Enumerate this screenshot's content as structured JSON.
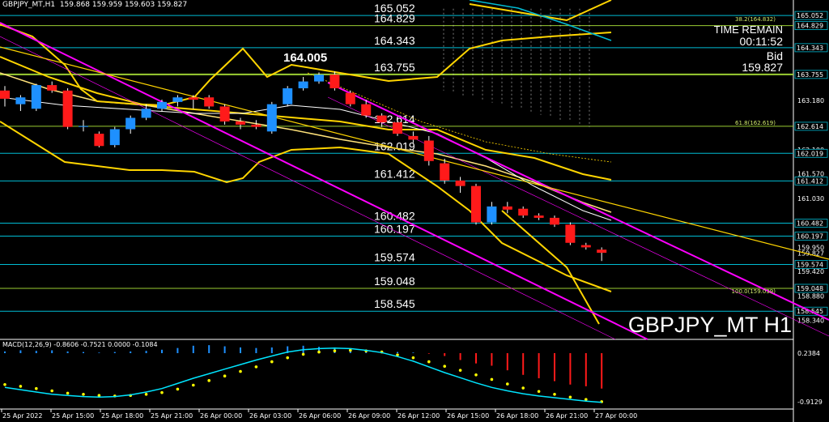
{
  "header": {
    "symbol_info": "GBPJPY_MT,H1",
    "ohlc": "159.868 159.959 159.603 159.827"
  },
  "symbol_label": "GBPJPY_MT H1",
  "timer": {
    "label": "TIME REMAIN",
    "value": "00:11:52",
    "bid_label": "Bid",
    "bid_value": "159.827"
  },
  "macd": {
    "header": "MACD(12,26,9) -0.8606 -0.7521 0.0000 -0.1084",
    "axis_top": "0.2384",
    "axis_bottom": "-0.9129"
  },
  "fib_annotations": [
    "38.2(164.832)",
    "61.8(162.619)",
    "100.0(159.039)"
  ],
  "colors": {
    "bull": "#1e90ff",
    "bear": "#ff1a1a",
    "bands": "#ffd500",
    "channel": "#ff00ff",
    "level": "#00bcd4",
    "macd_signal": "#ffff00",
    "macd_line": "#00e5ff"
  },
  "chart_data": {
    "type": "candlestick",
    "title": "GBPJPY_MT H1",
    "ylim": [
      158.05,
      165.25
    ],
    "y_ticks": [
      "165.052",
      "164.829",
      "164.343",
      "163.755",
      "163.180",
      "162.614",
      "162.100",
      "162.019",
      "161.570",
      "161.412",
      "161.030",
      "160.482",
      "160.197",
      "159.950",
      "159.827",
      "159.574",
      "159.420",
      "159.048",
      "158.880",
      "158.545",
      "158.340"
    ],
    "x_ticks": [
      "25 Apr 2022",
      "25 Apr 15:00",
      "25 Apr 18:00",
      "25 Apr 21:00",
      "26 Apr 00:00",
      "26 Apr 03:00",
      "26 Apr 06:00",
      "26 Apr 09:00",
      "26 Apr 12:00",
      "26 Apr 15:00",
      "26 Apr 18:00",
      "26 Apr 21:00",
      "27 Apr 00:00"
    ],
    "levels": [
      {
        "label": "165.052",
        "value": 165.052
      },
      {
        "label": "164.829",
        "value": 164.829
      },
      {
        "label": "164.343",
        "value": 164.343
      },
      {
        "label": "163.755",
        "value": 163.755
      },
      {
        "label": "162.614",
        "value": 162.614
      },
      {
        "label": "162.019",
        "value": 162.019
      },
      {
        "label": "161.412",
        "value": 161.412
      },
      {
        "label": "160.482",
        "value": 160.482
      },
      {
        "label": "160.197",
        "value": 160.197
      },
      {
        "label": "159.574",
        "value": 159.574
      },
      {
        "label": "159.048",
        "value": 159.048
      },
      {
        "label": "158.545",
        "value": 158.545
      }
    ],
    "peak_label": {
      "text": "164.005",
      "value": 164.005
    },
    "candles": [
      [
        163.4,
        163.5,
        163.05,
        163.22
      ],
      [
        163.1,
        163.3,
        162.95,
        163.25
      ],
      [
        163.0,
        163.55,
        162.95,
        163.52
      ],
      [
        163.52,
        163.6,
        163.35,
        163.4
      ],
      [
        163.4,
        163.45,
        162.55,
        162.6
      ],
      [
        162.6,
        162.75,
        162.5,
        162.62
      ],
      [
        162.45,
        162.5,
        162.15,
        162.18
      ],
      [
        162.2,
        162.6,
        162.15,
        162.55
      ],
      [
        162.55,
        162.85,
        162.45,
        162.8
      ],
      [
        162.8,
        163.1,
        162.75,
        163.0
      ],
      [
        163.0,
        163.2,
        162.95,
        163.15
      ],
      [
        163.15,
        163.3,
        163.05,
        163.25
      ],
      [
        163.25,
        163.3,
        163.0,
        163.2
      ],
      [
        163.25,
        163.3,
        163.0,
        163.05
      ],
      [
        163.05,
        163.1,
        162.65,
        162.72
      ],
      [
        162.72,
        162.8,
        162.55,
        162.65
      ],
      [
        162.65,
        162.75,
        162.55,
        162.6
      ],
      [
        162.5,
        163.15,
        162.45,
        163.1
      ],
      [
        163.1,
        163.5,
        163.05,
        163.45
      ],
      [
        163.45,
        163.7,
        163.4,
        163.6
      ],
      [
        163.6,
        163.8,
        163.55,
        163.75
      ],
      [
        163.75,
        163.82,
        163.4,
        163.45
      ],
      [
        163.35,
        163.4,
        163.05,
        163.1
      ],
      [
        163.1,
        163.2,
        162.8,
        162.85
      ],
      [
        162.85,
        162.9,
        162.6,
        162.7
      ],
      [
        162.7,
        162.8,
        162.4,
        162.45
      ],
      [
        162.4,
        162.5,
        162.25,
        162.32
      ],
      [
        162.3,
        162.4,
        161.75,
        161.85
      ],
      [
        161.8,
        161.9,
        161.35,
        161.42
      ],
      [
        161.42,
        161.5,
        161.15,
        161.3
      ],
      [
        161.3,
        161.35,
        160.45,
        160.5
      ],
      [
        160.5,
        160.95,
        160.45,
        160.85
      ],
      [
        160.85,
        160.95,
        160.7,
        160.78
      ],
      [
        160.8,
        160.85,
        160.6,
        160.65
      ],
      [
        160.65,
        160.7,
        160.55,
        160.6
      ],
      [
        160.6,
        160.65,
        160.4,
        160.45
      ],
      [
        160.45,
        160.5,
        160.0,
        160.05
      ],
      [
        160.0,
        160.05,
        159.9,
        159.95
      ],
      [
        159.9,
        159.95,
        159.65,
        159.83
      ]
    ],
    "macd_hist": [
      0.03,
      0.05,
      0.04,
      0.05,
      0.03,
      0.02,
      0.01,
      0.02,
      0.03,
      0.04,
      0.06,
      0.09,
      0.13,
      0.14,
      0.12,
      0.1,
      0.09,
      0.1,
      0.12,
      0.13,
      0.11,
      0.1,
      0.07,
      0.05,
      0.03,
      0.02,
      0.01,
      -0.01,
      -0.05,
      -0.12,
      -0.18,
      -0.22,
      -0.3,
      -0.38,
      -0.44,
      -0.49,
      -0.55,
      -0.58,
      -0.62
    ],
    "macd_signal": [
      -0.55,
      -0.58,
      -0.62,
      -0.66,
      -0.7,
      -0.72,
      -0.74,
      -0.75,
      -0.74,
      -0.72,
      -0.69,
      -0.63,
      -0.56,
      -0.48,
      -0.4,
      -0.32,
      -0.24,
      -0.15,
      -0.08,
      -0.02,
      0.02,
      0.04,
      0.05,
      0.04,
      0.02,
      -0.03,
      -0.08,
      -0.15,
      -0.23,
      -0.3,
      -0.38,
      -0.46,
      -0.54,
      -0.61,
      -0.67,
      -0.72,
      -0.77,
      -0.81,
      -0.85
    ],
    "macd_line": [
      -0.6,
      -0.64,
      -0.68,
      -0.72,
      -0.74,
      -0.76,
      -0.77,
      -0.76,
      -0.73,
      -0.68,
      -0.62,
      -0.53,
      -0.44,
      -0.36,
      -0.28,
      -0.2,
      -0.12,
      -0.05,
      0.02,
      0.06,
      0.08,
      0.09,
      0.08,
      0.05,
      0.01,
      -0.06,
      -0.14,
      -0.24,
      -0.34,
      -0.43,
      -0.52,
      -0.6,
      -0.66,
      -0.71,
      -0.75,
      -0.78,
      -0.81,
      -0.84,
      -0.86
    ]
  }
}
